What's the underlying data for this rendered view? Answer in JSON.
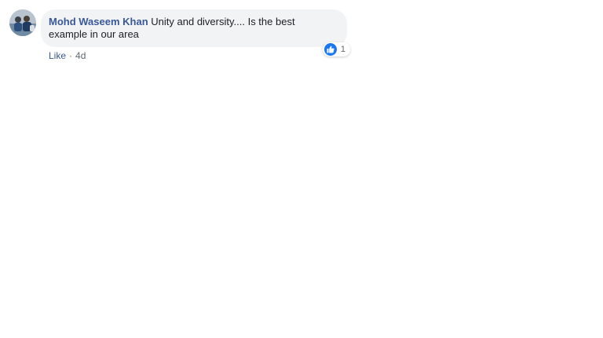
{
  "comment": {
    "author": "Mohd Waseem Khan",
    "text": "Unity and diversity.... Is the best example in our area",
    "reaction_count": "1",
    "actions": {
      "like_label": "Like",
      "separator": "·",
      "timestamp": "4d"
    }
  },
  "colors": {
    "author": "#385898",
    "bubble": "#f2f3f5",
    "like_badge": "#1877f2",
    "meta_text": "#606770"
  },
  "icons": {
    "reaction": "thumbs-up-icon"
  }
}
